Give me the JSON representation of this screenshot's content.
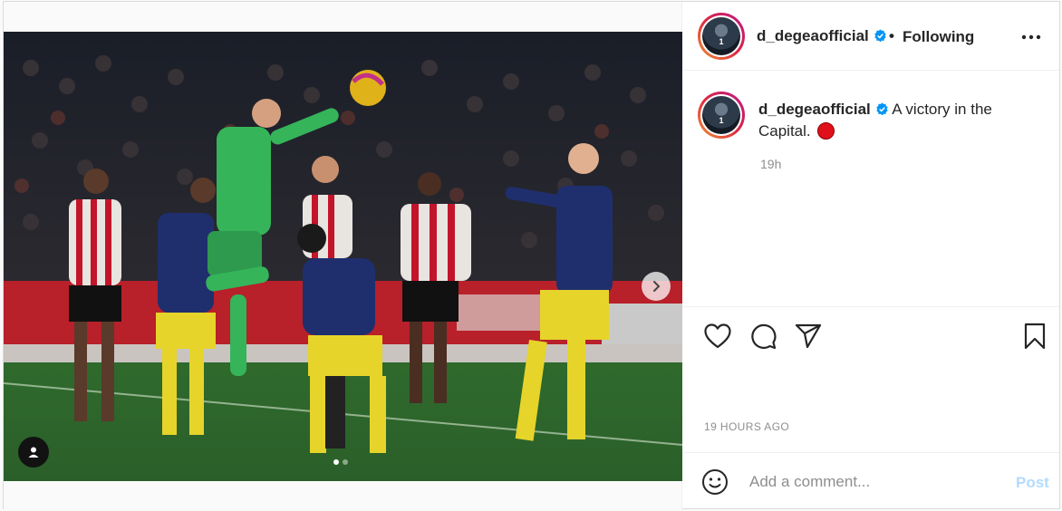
{
  "post": {
    "username": "d_degeaofficial",
    "avatar_label": "1",
    "separator": "•",
    "follow_status": "Following",
    "more_icon": "more-horizontal-icon",
    "verified_color": "#0095f6"
  },
  "caption": {
    "username": "d_degeaofficial",
    "text": "A victory in the Capital.",
    "emoji": "red-circle",
    "time": "19h"
  },
  "media": {
    "description_icons": [
      "chevron-right-icon",
      "user-tag-icon"
    ],
    "slide_count": 2,
    "active_slide": 1
  },
  "actions": {
    "icons": [
      "heart-icon",
      "comment-icon",
      "share-icon",
      "bookmark-icon"
    ]
  },
  "timestamp": "19 HOURS AGO",
  "comment": {
    "placeholder": "Add a comment...",
    "post_label": "Post",
    "post_color": "#b3dbff"
  }
}
